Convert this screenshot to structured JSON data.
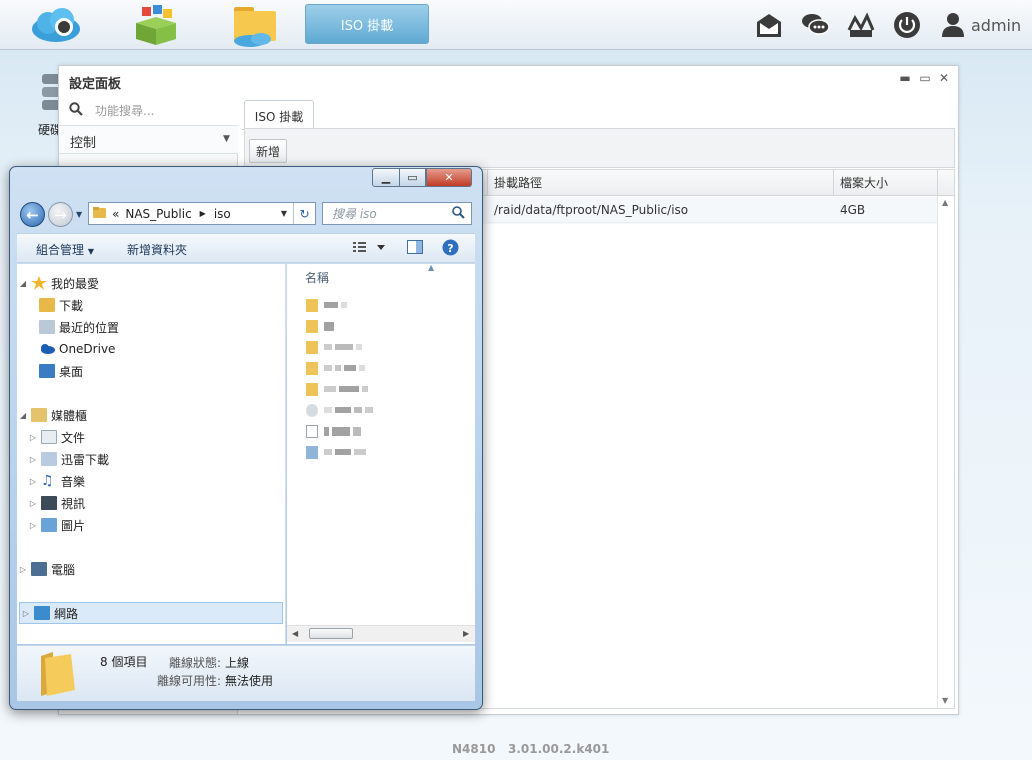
{
  "topbar": {
    "icons": [
      "cloud-icon",
      "apps-box-icon",
      "folder-cloud-icon"
    ],
    "active_app": "ISO 掛載",
    "right_icons": [
      "mail-icon",
      "chat-icon",
      "nas-status-icon",
      "power-icon",
      "user-icon"
    ],
    "user": "admin"
  },
  "desktop": {
    "icon_label": "硬碟"
  },
  "panel": {
    "title": "設定面板",
    "nav": {
      "search_placeholder": "功能搜尋...",
      "category": "控制"
    },
    "tab": "ISO 掛載",
    "add_button": "新增",
    "table": {
      "columns": [
        "",
        "掛載路徑",
        "檔案大小"
      ],
      "rows": [
        {
          "name": "",
          "path": "/raid/data/ftproot/NAS_Public/iso",
          "size": "4GB"
        }
      ]
    }
  },
  "footer": {
    "model": "N4810",
    "version": "3.01.00.2.k401"
  },
  "explorer": {
    "address": {
      "prefix": "«",
      "parts": [
        "NAS_Public",
        "iso"
      ]
    },
    "search_placeholder": "搜尋 iso",
    "commands": {
      "organize": "組合管理",
      "new_folder": "新增資料夾"
    },
    "nav": {
      "favorites": {
        "label": "我的最愛",
        "items": [
          "下載",
          "最近的位置",
          "OneDrive",
          "桌面"
        ]
      },
      "libraries": {
        "label": "媒體櫃",
        "items": [
          "文件",
          "迅雷下載",
          "音樂",
          "視訊",
          "圖片"
        ]
      },
      "computer": "電腦",
      "network": "網路"
    },
    "column_header": "名稱",
    "status": {
      "count": "8 個項目",
      "offline_status_label": "離線狀態:",
      "offline_status_value": "上線",
      "offline_avail_label": "離線可用性:",
      "offline_avail_value": "無法使用"
    }
  }
}
